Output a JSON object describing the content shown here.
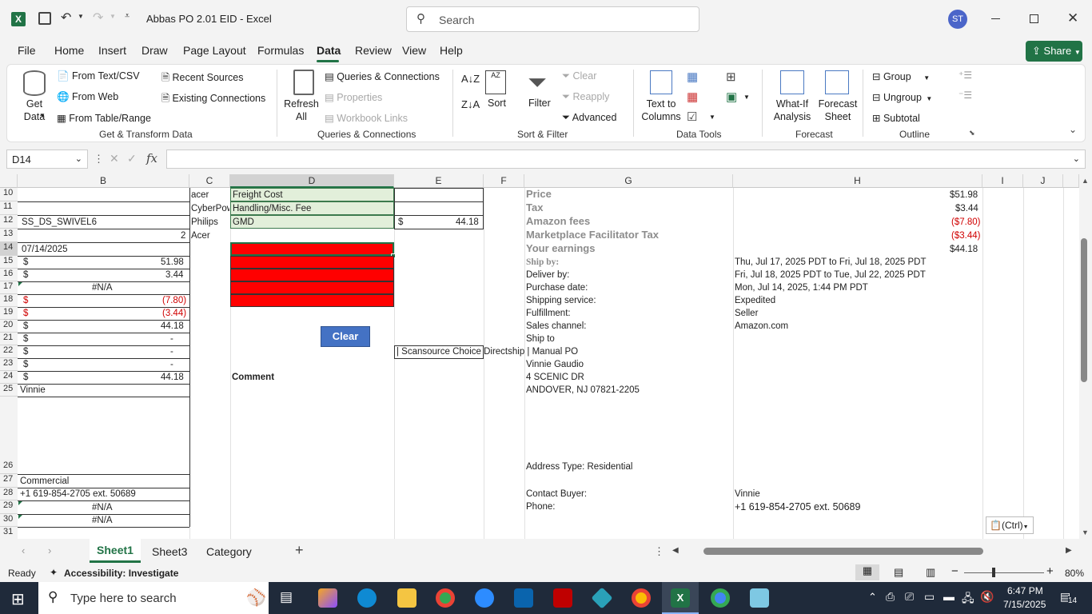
{
  "titlebar": {
    "filename": "Abbas PO 2.01 EID - Excel",
    "search_placeholder": "Search",
    "avatar": "ST"
  },
  "ribbon_tabs": [
    "File",
    "Home",
    "Insert",
    "Draw",
    "Page Layout",
    "Formulas",
    "Data",
    "Review",
    "View",
    "Help"
  ],
  "share": "Share",
  "ribbon": {
    "get_data": "Get Data",
    "from_text": "From Text/CSV",
    "from_web": "From Web",
    "from_table": "From Table/Range",
    "recent_sources": "Recent Sources",
    "existing_connections": "Existing Connections",
    "group_get": "Get & Transform Data",
    "refresh_all": "Refresh All",
    "queries_connections": "Queries & Connections",
    "properties": "Properties",
    "workbook_links": "Workbook Links",
    "group_queries": "Queries & Connections",
    "sort": "Sort",
    "filter": "Filter",
    "clear": "Clear",
    "reapply": "Reapply",
    "advanced": "Advanced",
    "group_sort": "Sort & Filter",
    "text_to_columns": "Text to Columns",
    "group_tools": "Data Tools",
    "what_if": "What-If Analysis",
    "forecast_sheet": "Forecast Sheet",
    "group_forecast": "Forecast",
    "group": "Group",
    "ungroup": "Ungroup",
    "subtotal": "Subtotal",
    "group_outline": "Outline"
  },
  "namebox": "D14",
  "columns": [
    "B",
    "C",
    "D",
    "E",
    "F",
    "G",
    "H",
    "I",
    "J"
  ],
  "rows": [
    "10",
    "11",
    "12",
    "13",
    "14",
    "15",
    "16",
    "17",
    "18",
    "19",
    "20",
    "21",
    "22",
    "23",
    "24",
    "25",
    "26",
    "27",
    "28",
    "29",
    "30",
    "31"
  ],
  "cells": {
    "b12": "SS_DS_SWIVEL6",
    "b13": "2",
    "b14": "07/14/2025",
    "b15v": "51.98",
    "b16v": "3.44",
    "b17": "#N/A",
    "b18v": "(7.80)",
    "b19v": "(3.44)",
    "b20v": "44.18",
    "b21v": "-",
    "b22v": "-",
    "b23v": "-",
    "b24v": "44.18",
    "dollar": "$",
    "b25": "Vinnie",
    "b27": "Commercial",
    "b28": "+1 619-854-2705 ext. 50689",
    "b29": "#N/A",
    "b30": "#N/A",
    "c10": "acer",
    "c11": "CyberPow",
    "c12": "Philips",
    "c13": "Acer",
    "d10": "Freight Cost",
    "d11": "Handling/Misc. Fee",
    "d12": "GMD",
    "e12v": "44.18",
    "clear_btn": "Clear",
    "e22": "| Scansource Choice Directship | Manual PO",
    "d24": "Comment",
    "g10": "Price",
    "g11": "Tax",
    "g12": "Amazon fees",
    "g13": "Marketplace Facilitator Tax",
    "g14": "Your earnings",
    "g15": "Ship by:",
    "g16": "Deliver by:",
    "g17": "Purchase date:",
    "g18": "Shipping service:",
    "g19": "Fulfillment:",
    "g20": "Sales channel:",
    "g21": "Ship to",
    "g23": "Vinnie Gaudio",
    "g24": "4 SCENIC DR",
    "g25": "ANDOVER, NJ 07821-2205",
    "g26": "Address Type:  Residential",
    "g28": "Contact Buyer:",
    "g29": "Phone:",
    "h10": "$51.98",
    "h11": "$3.44",
    "h12": "($7.80)",
    "h13": "($3.44)",
    "h14": "$44.18",
    "h15": "Thu, Jul 17, 2025 PDT to Fri, Jul 18, 2025 PDT",
    "h16": "Fri, Jul 18, 2025 PDT to Tue, Jul 22, 2025 PDT",
    "h17": "Mon, Jul 14, 2025, 1:44 PM PDT",
    "h18": "Expedited",
    "h19": "Seller",
    "h20": "Amazon.com",
    "h28": "Vinnie",
    "h29": "+1 619-854-2705 ext. 50689"
  },
  "paste_options": "(Ctrl)",
  "sheets": [
    "Sheet1",
    "Sheet3",
    "Category"
  ],
  "status": {
    "ready": "Ready",
    "accessibility": "Accessibility: Investigate",
    "zoom": "80%"
  },
  "taskbar": {
    "search_placeholder": "Type here to search",
    "time": "6:47 PM",
    "date": "7/15/2025",
    "notifications": "14"
  },
  "colors": {
    "excel_green": "#217346",
    "red_fill": "#ff0000",
    "light_green": "#e2efda",
    "clear_button": "#4472c4"
  }
}
